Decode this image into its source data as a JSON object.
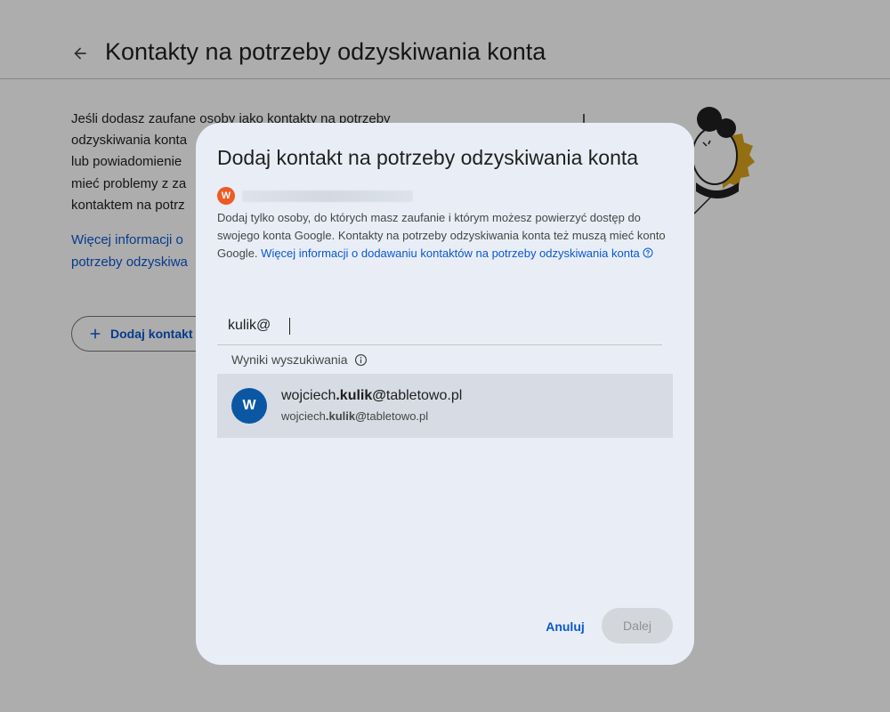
{
  "page": {
    "title": "Kontakty na potrzeby odzyskiwania konta",
    "intro_lines": [
      "Jeśli dodasz zaufane osoby jako kontakty na potrzeby",
      "odzyskiwania konta",
      "lub powiadomienie",
      "mieć problemy z za",
      "kontaktem na potrz"
    ],
    "more_info_lines": [
      "Więcej informacji o",
      "potrzeby odzyskiwa"
    ],
    "add_contact_button": "Dodaj kontakt n"
  },
  "dialog": {
    "title": "Dodaj kontakt na potrzeby odzyskiwania konta",
    "account_initial": "W",
    "description": "Dodaj tylko osoby, do których masz zaufanie i którym możesz powierzyć dostęp do swojego konta Google. Kontakty na potrzeby odzyskiwania konta też muszą mieć konto Google.",
    "learn_more_link": "Więcej informacji o dodawaniu kontaktów na potrzeby odzyskiwania konta",
    "search_value": "kulik@",
    "results_label": "Wyniki wyszukiwania",
    "result": {
      "initial": "W",
      "name_prefix": "wojciech",
      "name_match": ".kulik@",
      "name_suffix": "tabletowo.pl",
      "email_prefix": "wojciech",
      "email_match": ".kulik@",
      "email_suffix": "tabletowo.pl"
    },
    "cancel_label": "Anuluj",
    "next_label": "Dalej"
  },
  "colors": {
    "accent": "#0b57d0",
    "dialog_bg": "#e9eef6",
    "result_highlight": "#d7dce4",
    "result_avatar": "#0b57a4",
    "account_avatar": "#ee5a24",
    "illustration_yellow": "#d9a21b"
  },
  "icons": {
    "back": "arrow-back-icon",
    "add": "plus-icon",
    "help": "help-circle-icon",
    "info": "info-icon"
  }
}
